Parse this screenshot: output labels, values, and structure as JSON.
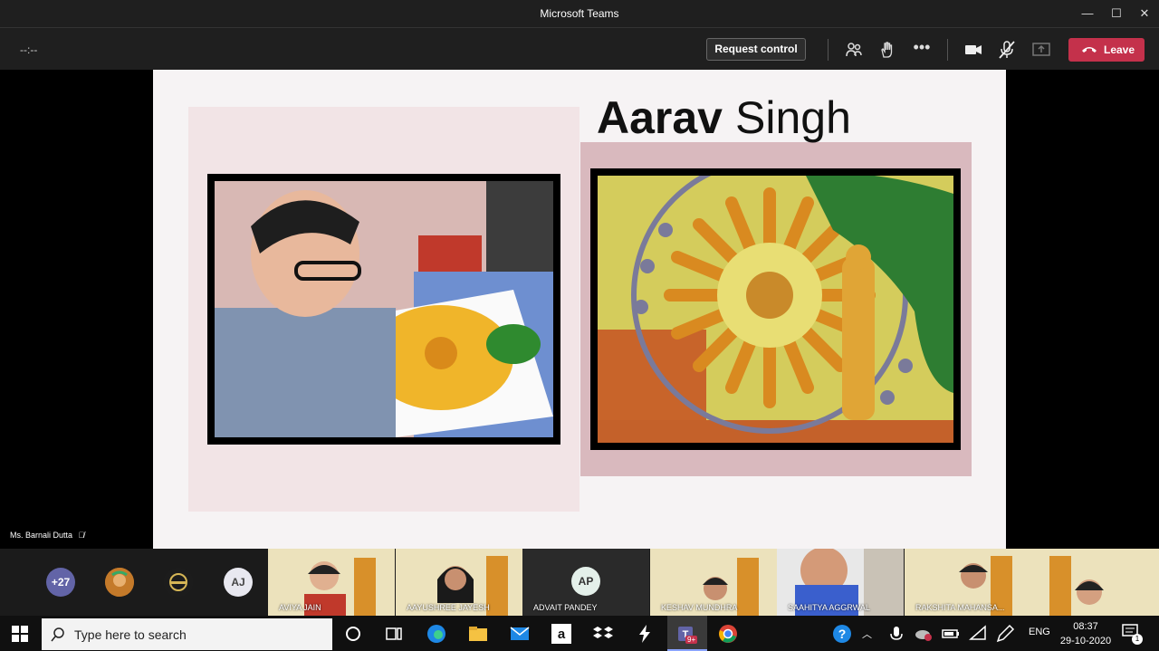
{
  "window": {
    "title": "Microsoft Teams"
  },
  "toolbar": {
    "timer": "--:--",
    "request_control": "Request control",
    "leave": "Leave"
  },
  "slide": {
    "first_name": "Aarav",
    "last_name": "Singh"
  },
  "presenter": {
    "name": "Ms. Barnali Dutta"
  },
  "participants": {
    "overflow": "+27",
    "avatars": [
      {
        "initials": "AJ",
        "color": "#e8e8f0"
      },
      {
        "initials": "AP",
        "color": "#e4f0ea"
      }
    ],
    "tiles": [
      {
        "name": "AVIYA JAIN"
      },
      {
        "name": "AAYUSHREE JAYESH"
      },
      {
        "name": "ADVAIT PANDEY"
      },
      {
        "name": "KESHAV MUNDHRA"
      },
      {
        "name": "SAAHITYA AGGRWAL"
      },
      {
        "name": "RAKSHITA MAHANSA..."
      }
    ]
  },
  "taskbar": {
    "search_placeholder": "Type here to search",
    "teams_badge": "9+",
    "language": "ENG",
    "time": "08:37",
    "date": "29-10-2020",
    "notification_count": "1"
  },
  "colors": {
    "leave": "#c4314b",
    "teams_purple": "#6264a7"
  }
}
